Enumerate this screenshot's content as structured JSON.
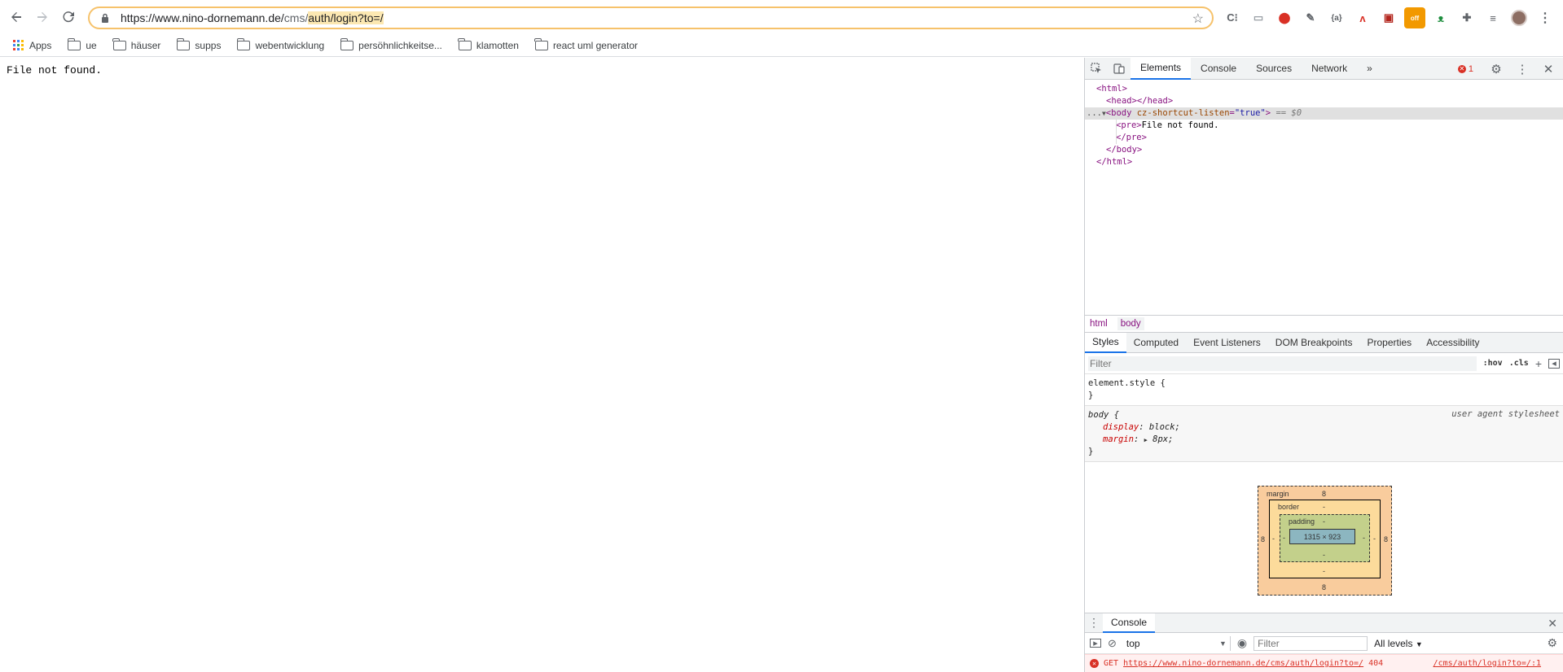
{
  "browser": {
    "url": {
      "host_part": "https://www.nino-dornemann.de/",
      "path_part": "cms/",
      "selected_part": "auth/login?to=/"
    },
    "bookmarks": {
      "apps": "Apps",
      "items": [
        "ue",
        "häuser",
        "supps",
        "webentwicklung",
        "persöhnlichkeitse...",
        "klamotten",
        "react uml generator"
      ]
    },
    "extensions": [
      "C⁝",
      "▭",
      "⬤",
      "✎",
      "{a}",
      "ᴧ",
      "▣",
      "off",
      "ᴥ",
      "✚",
      "≡",
      ""
    ]
  },
  "page": {
    "text": "File not found."
  },
  "devtools": {
    "tabs": [
      "Elements",
      "Console",
      "Sources",
      "Network"
    ],
    "more_tabs": "»",
    "error_count": "1",
    "dom": {
      "html_open": "<html>",
      "head": "<head></head>",
      "body_open_tag": "<body",
      "body_attr_name": "cz-shortcut-listen",
      "body_attr_val": "\"true\"",
      "body_close_bracket": ">",
      "selected_marker": "== $0",
      "pre_open": "<pre>",
      "pre_text": "File not found.",
      "pre_close": "</pre>",
      "body_close": "</body>",
      "html_close": "</html>",
      "ellipsis": "..."
    },
    "breadcrumbs": [
      "html",
      "body"
    ],
    "subtabs": [
      "Styles",
      "Computed",
      "Event Listeners",
      "DOM Breakpoints",
      "Properties",
      "Accessibility"
    ],
    "styles": {
      "filter_placeholder": "Filter",
      "hov": ":hov",
      "cls": ".cls",
      "element_style": "element.style {",
      "close_brace": "}",
      "body_selector": "body {",
      "ua_label": "user agent stylesheet",
      "props": [
        {
          "name": "display",
          "value": "block;"
        },
        {
          "name": "margin",
          "value": "8px;"
        }
      ]
    },
    "box_model": {
      "margin_label": "margin",
      "border_label": "border",
      "padding_label": "padding",
      "margin_top": "8",
      "margin_bottom": "8",
      "margin_left": "8",
      "margin_right": "8",
      "border_value": "-",
      "padding_value": "-",
      "content_size": "1315 × 923"
    },
    "console": {
      "title": "Console",
      "context": "top",
      "filter_placeholder": "Filter",
      "levels": "All levels",
      "error": {
        "method": "GET",
        "url": "https://www.nino-dornemann.de/cms/auth/login?to=/",
        "status": "404",
        "source": "/cms/auth/login?to=/:1"
      }
    }
  },
  "colors": {
    "omnibox_border": "#f6c26b",
    "selection": "#fce8b2",
    "accent": "#1a73e8",
    "error": "#d93025"
  }
}
